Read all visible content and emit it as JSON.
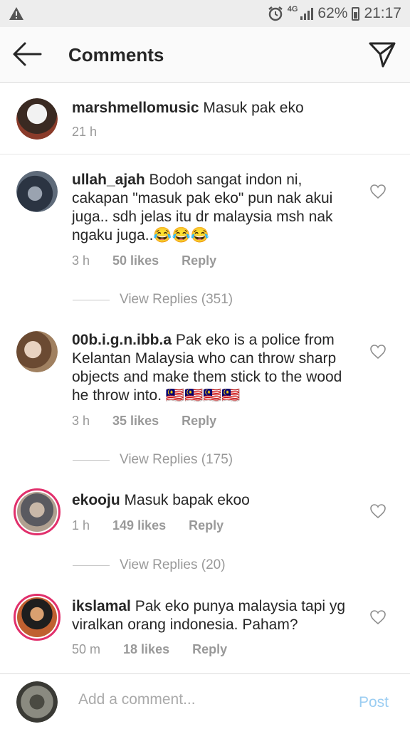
{
  "status_bar": {
    "warning_icon": "warning-triangle-icon",
    "alarm_icon": "alarm-clock-icon",
    "network": "4G",
    "battery": "62%",
    "time": "21:17"
  },
  "header": {
    "title": "Comments",
    "back_icon": "arrow-left-icon",
    "send_icon": "send-icon"
  },
  "caption": {
    "username": "marshmellomusic",
    "text": "Masuk pak eko",
    "time": "21 h"
  },
  "comments": [
    {
      "username": "ullah_ajah",
      "text": "Bodoh sangat indon ni, cakapan \"masuk pak eko\" pun nak akui juga.. sdh jelas itu dr malaysia msh nak ngaku juga..😂😂😂",
      "time": "3 h",
      "likes": "50 likes",
      "reply": "Reply",
      "view_replies": "View Replies (351)"
    },
    {
      "username": "00b.i.g.n.ibb.a",
      "text": "Pak eko is a police from Kelantan Malaysia who can throw sharp objects and make them stick to the wood he throw into. 🇲🇾🇲🇾🇲🇾🇲🇾",
      "time": "3 h",
      "likes": "35 likes",
      "reply": "Reply",
      "view_replies": "View Replies (175)"
    },
    {
      "username": "ekooju",
      "text": "Masuk bapak ekoo",
      "time": "1 h",
      "likes": "149 likes",
      "reply": "Reply",
      "view_replies": "View Replies (20)"
    },
    {
      "username": "ikslamal",
      "text": "Pak eko punya malaysia tapi yg viralkan orang indonesia. Paham?",
      "time": "50 m",
      "likes": "18 likes",
      "reply": "Reply"
    }
  ],
  "composer": {
    "placeholder": "Add a comment...",
    "post_label": "Post"
  },
  "colors": {
    "accent_ring": "#e1306c",
    "post_disabled": "#9bcdf2",
    "meta_gray": "#999999"
  }
}
